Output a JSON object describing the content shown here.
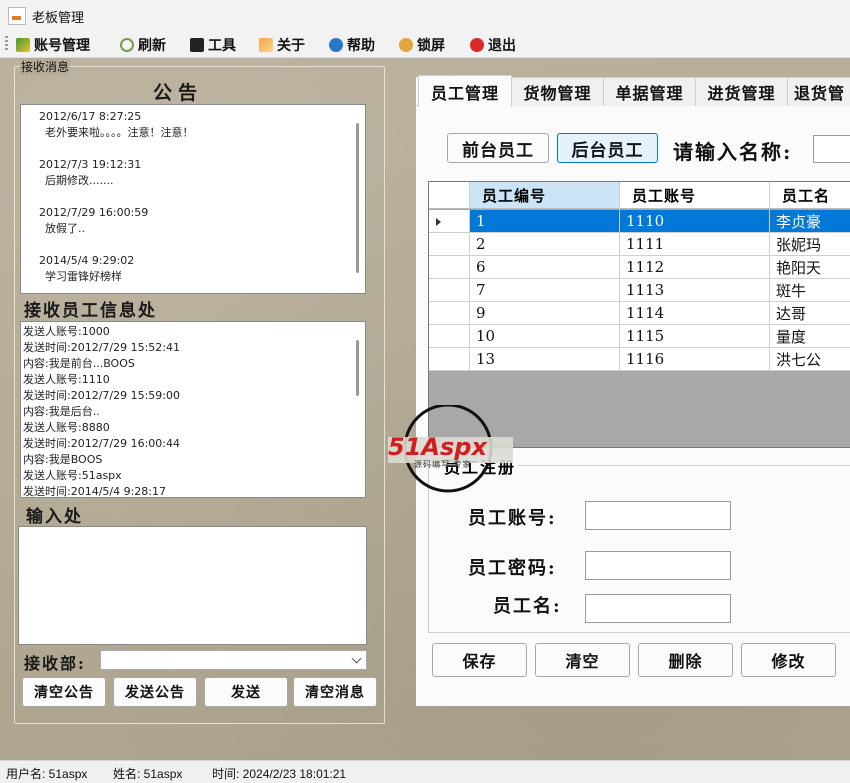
{
  "window": {
    "title": "老板管理"
  },
  "menu": [
    {
      "label": "账号管理",
      "icon": "account-icon"
    },
    {
      "label": "刷新",
      "icon": "refresh-icon"
    },
    {
      "label": "工具",
      "icon": "tools-icon"
    },
    {
      "label": "关于",
      "icon": "about-icon"
    },
    {
      "label": "帮助",
      "icon": "help-icon"
    },
    {
      "label": "锁屏",
      "icon": "lock-screen-icon"
    },
    {
      "label": "退出",
      "icon": "exit-icon"
    }
  ],
  "left": {
    "group_label": "接收消息",
    "notice_title": "公告",
    "notices": [
      {
        "time": "2012/6/17 8:27:25",
        "body": "老外要来啦。。。。注意！注意！"
      },
      {
        "time": "2012/7/3 19:12:31",
        "body": "后期修改......."
      },
      {
        "time": "2012/7/29 16:00:59",
        "body": "放假了.."
      },
      {
        "time": "2014/5/4 9:29:02",
        "body": "学习雷锋好榜样"
      }
    ],
    "messages_title": "接收员工信息处",
    "messages": [
      "发送人账号:1000",
      "发送时间:2012/7/29 15:52:41",
      "内容:我是前台...BOOS",
      "发送人账号:1110",
      "发送时间:2012/7/29 15:59:00",
      "内容:我是后台..",
      "发送人账号:8880",
      "发送时间:2012/7/29 16:00:44",
      "内容:我是BOOS",
      "发送人账号:51aspx",
      "发送时间:2014/5/4 9:28:17"
    ],
    "input_title": "输入处",
    "input_value": "",
    "receiver_label": "接收部:",
    "receiver_value": "",
    "buttons": {
      "clear_notice": "清空公告",
      "send_notice": "发送公告",
      "send": "发送",
      "clear_message": "清空消息"
    }
  },
  "tabs": [
    "员工管理",
    "货物管理",
    "单据管理",
    "进货管理",
    "退货管"
  ],
  "staff": {
    "front_button": "前台员工",
    "back_button": "后台员工",
    "search_label": "请输入名称:",
    "search_value": "",
    "columns": [
      "员工编号",
      "员工账号",
      "员工名"
    ],
    "rows": [
      {
        "id": "1",
        "account": "1110",
        "name": "李贞豪"
      },
      {
        "id": "2",
        "account": "1111",
        "name": "张妮玛"
      },
      {
        "id": "6",
        "account": "1112",
        "name": "艳阳天"
      },
      {
        "id": "7",
        "account": "1113",
        "name": "斑牛"
      },
      {
        "id": "9",
        "account": "1114",
        "name": "达哥"
      },
      {
        "id": "10",
        "account": "1115",
        "name": "量度"
      },
      {
        "id": "13",
        "account": "1116",
        "name": "洪七公"
      }
    ],
    "selected_row_index": 0,
    "register_title": "员工注册",
    "fields": {
      "account_label": "员工账号:",
      "password_label": "员工密码:",
      "name_label": "员工名:"
    },
    "actions": {
      "save": "保存",
      "clear": "清空",
      "delete": "删除",
      "modify": "修改"
    }
  },
  "watermark": {
    "brand": "51Aspx",
    "sub": "源码编写·专家"
  },
  "status": {
    "user": "用户名: 51aspx",
    "name": "姓名: 51aspx",
    "time": "时间: 2024/2/23 18:01:21"
  },
  "colors": {
    "selection": "#0078d7",
    "logo_red": "#d11f1f",
    "logo_green": "#5aa52a"
  }
}
